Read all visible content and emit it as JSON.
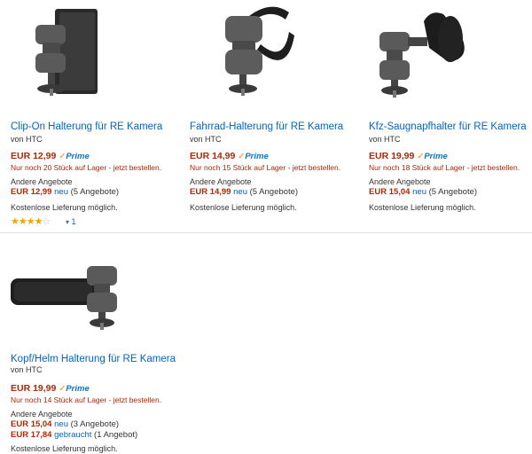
{
  "products": [
    {
      "title": "Clip-On Halterung für RE Kamera",
      "brand": "von HTC",
      "price": "EUR 12,99",
      "prime": "Prime",
      "stock": "Nur noch 20 Stück auf Lager - jetzt bestellen.",
      "other_label": "Andere Angebote",
      "offers": [
        {
          "price": "EUR 12,99",
          "condition": "neu",
          "count": "(5 Angebote)"
        }
      ],
      "shipping": "Kostenlose Lieferung möglich.",
      "rating_stars": 4,
      "review_count": "1"
    },
    {
      "title": "Fahrrad-Halterung für RE Kamera",
      "brand": "von HTC",
      "price": "EUR 14,99",
      "prime": "Prime",
      "stock": "Nur noch 15 Stück auf Lager - jetzt bestellen.",
      "other_label": "Andere Angebote",
      "offers": [
        {
          "price": "EUR 14,99",
          "condition": "neu",
          "count": "(5 Angebote)"
        }
      ],
      "shipping": "Kostenlose Lieferung möglich."
    },
    {
      "title": "Kfz-Saugnapfhalter für RE Kamera",
      "brand": "von HTC",
      "price": "EUR 19,99",
      "prime": "Prime",
      "stock": "Nur noch 18 Stück auf Lager - jetzt bestellen.",
      "other_label": "Andere Angebote",
      "offers": [
        {
          "price": "EUR 15,04",
          "condition": "neu",
          "count": "(5 Angebote)"
        }
      ],
      "shipping": "Kostenlose Lieferung möglich."
    },
    {
      "title": "Kopf/Helm Halterung für RE Kamera",
      "brand": "von HTC",
      "price": "EUR 19,99",
      "prime": "Prime",
      "stock": "Nur noch 14 Stück auf Lager - jetzt bestellen.",
      "other_label": "Andere Angebote",
      "offers": [
        {
          "price": "EUR 15,04",
          "condition": "neu",
          "count": "(3 Angebote)"
        },
        {
          "price": "EUR 17,84",
          "condition": "gebraucht",
          "count": "(1 Angebot)"
        }
      ],
      "shipping": "Kostenlose Lieferung möglich."
    }
  ],
  "colors": {
    "link": "#0066c0",
    "price": "#b12704",
    "prime": "#0a76c1",
    "star": "#f0a30a"
  }
}
